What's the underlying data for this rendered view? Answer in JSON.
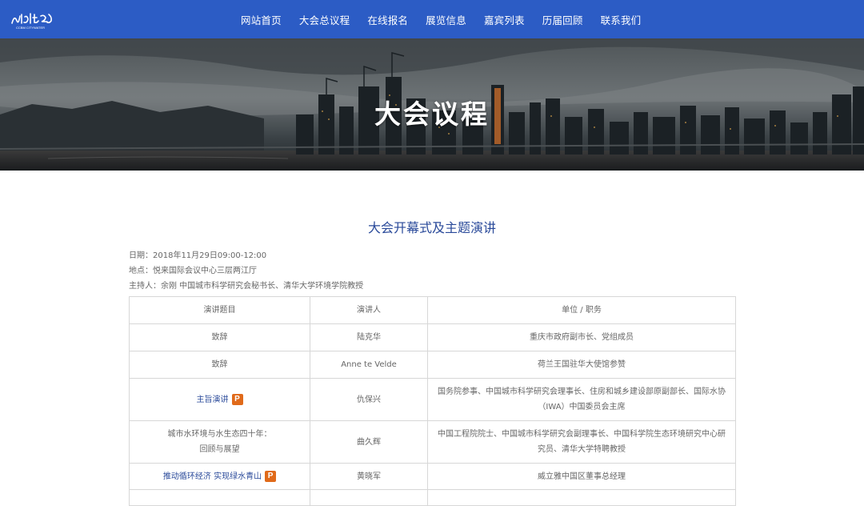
{
  "nav": {
    "logo_text": "城市水世界",
    "logo_subtext": "CCBM CITYWATER",
    "items": [
      "网站首页",
      "大会总议程",
      "在线报名",
      "展览信息",
      "嘉宾列表",
      "历届回顾",
      "联系我们"
    ]
  },
  "banner": {
    "title": "大会议程"
  },
  "session": {
    "title": "大会开幕式及主题演讲",
    "date": "日期：2018年11月29日09:00-12:00",
    "venue": "地点：悦来国际会议中心三层两江厅",
    "host": "主持人：余刚 中国城市科学研究会秘书长、清华大学环境学院教授"
  },
  "table": {
    "headers": [
      "演讲题目",
      "演讲人",
      "单位 / 职务"
    ],
    "rows": [
      {
        "topic": "致辞",
        "speaker": "陆克华",
        "org": "重庆市政府副市长、党组成员"
      },
      {
        "topic": "致辞",
        "speaker": "Anne te Velde",
        "org": "荷兰王国驻华大使馆参赞"
      },
      {
        "topic": "主旨演讲",
        "speaker": "仇保兴",
        "org_line1": "国务院参事、中国城市科学研究会理事长、住房和城乡建设部原副部长、国际水协",
        "org_line2": "（IWA）中国委员会主席"
      },
      {
        "topic_line1": "城市水环境与水生态四十年：",
        "topic_line2": "回顾与展望",
        "speaker": "曲久辉",
        "org_line1": "中国工程院院士、中国城市科学研究会副理事长、中国科学院生态环境研究中心研",
        "org_line2": "究员、清华大学特聘教授"
      },
      {
        "topic": "推动循环经济 实现绿水青山",
        "speaker": "黄晓军",
        "org": "威立雅中国区董事总经理"
      }
    ],
    "ppt_badge": "P"
  },
  "colors": {
    "nav_bg": "#2c5cc5",
    "link": "#2a4a9a",
    "ppt_badge": "#e06a1a"
  }
}
